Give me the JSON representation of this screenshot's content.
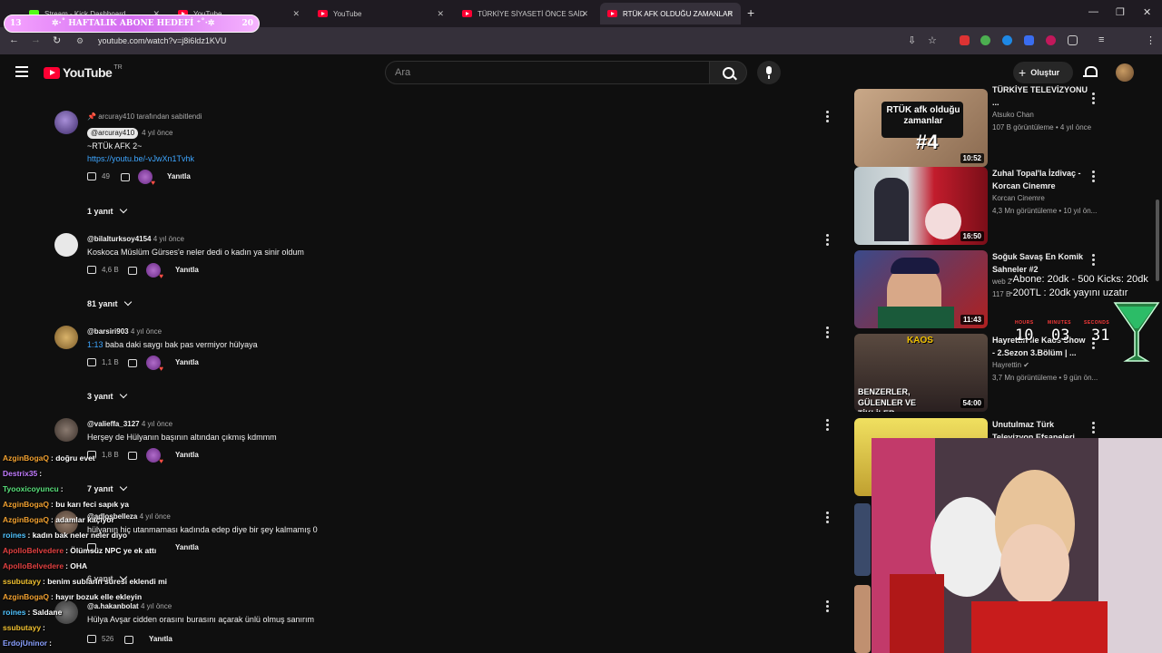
{
  "browser": {
    "tabs": [
      {
        "label": "Stream - Kick Dashboard",
        "type": "kick"
      },
      {
        "label": "YouTube",
        "type": "yt"
      },
      {
        "label": "YouTube",
        "type": "yt"
      },
      {
        "label": "TÜRKİYE SİYASETİ ÖNCE SAİD",
        "type": "yt"
      },
      {
        "label": "RTÜK AFK OLDUĞU ZAMANLAR",
        "type": "yt",
        "active": true
      }
    ],
    "url": "youtube.com/watch?v=j8i6ldz1KVU",
    "profile_letter": "C"
  },
  "overlay": {
    "banner_left": "13",
    "banner_text": "✲·˚ HAFTALIK ABONE HEDEFİ ⁺˚·✲",
    "banner_right": "20",
    "goal_line1": "-Abone: 20dk - 500 Kicks: 20dk",
    "goal_line2": "-200TL : 20dk yayını uzatır",
    "timer": {
      "hours_label": "HOURS",
      "minutes_label": "MINUTES",
      "seconds_label": "SECONDS",
      "hours": "10",
      "minutes": "03",
      "seconds": "31"
    }
  },
  "youtube": {
    "logo_text": "YouTube",
    "region": "TR",
    "search_placeholder": "Ara",
    "create_label": "Oluştur"
  },
  "comments": [
    {
      "pinned": "arcuray410 tarafından sabitlendi",
      "author": "@arcuray410",
      "time": "4 yıl önce",
      "text": "~RTÜk AFK 2~",
      "link": "https://youtu.be/-vJwXn1Tvhk",
      "likes": "49",
      "reply_label": "Yanıtla",
      "replies": "1 yanıt"
    },
    {
      "author": "@bilalturksoy4154",
      "time": "4 yıl önce",
      "text": "Koskoca Müslüm Gürses'e neler dedi o kadın ya sinir oldum",
      "likes": "4,6 B",
      "reply_label": "Yanıtla",
      "replies": "81 yanıt"
    },
    {
      "author": "@barsiri903",
      "time": "4 yıl önce",
      "timestamp_link": "1:13",
      "text": "baba daki saygı bak pas vermiyor hülyaya",
      "likes": "1,1 B",
      "reply_label": "Yanıtla",
      "replies": "3 yanıt"
    },
    {
      "author": "@valieffa_3127",
      "time": "4 yıl önce",
      "text": "Herşey de Hülyanın başının altından çıkmış kdmmm",
      "likes": "1,8 B",
      "reply_label": "Yanıtla",
      "replies": "7 yanıt"
    },
    {
      "author": "@adlosbelleza",
      "time": "4 yıl önce",
      "text": "hülyanın hiç utanmaması kadında edep diye bir şey kalmamış 0",
      "likes": "",
      "reply_label": "Yanıtla",
      "replies": "6 yanıt"
    },
    {
      "author": "@a.hakanbolat",
      "time": "4 yıl önce",
      "text": "Hülya Avşar cidden orasını burasını açarak ünlü olmuş sanırım",
      "likes": "526",
      "reply_label": "Yanıtla"
    }
  ],
  "recommendations": [
    {
      "title": "TÜRKİYE TELEVİZYONU ...",
      "channel": "Atsuko Chan",
      "stats": "107 B görüntüleme • 4 yıl önce",
      "duration": "10:52",
      "thumb_text": "RTÜK afk olduğu zamanlar",
      "thumb_num": "#4"
    },
    {
      "title": "Zuhal Topal'la İzdivaç - Korcan Cinemre",
      "channel": "Korcan Cinemre",
      "stats": "4,3 Mn görüntüleme • 10 yıl ön...",
      "duration": "16:50"
    },
    {
      "title": "Soğuk Savaş En Komik Sahneler #2",
      "channel": "web 2",
      "stats": "117 B",
      "duration": "11:43"
    },
    {
      "title": "Hayrettin ile Kaos Show - 2.Sezon 3.Bölüm | ...",
      "channel": "Hayrettin",
      "stats": "3,7 Mn görüntüleme • 9 gün ön...",
      "duration": "54:00",
      "thumb_text": "BENZERLER, GÜLENLER VE TİKLİLER",
      "thumb_brand": "KAOS"
    },
    {
      "title": "Unutulmaz Türk Televizyon Efsaneleri",
      "channel": "",
      "stats": "",
      "duration": ""
    }
  ],
  "chat": [
    {
      "user": "AzginBogaQ",
      "msg": ": doğru evet",
      "color": "#f0a030"
    },
    {
      "user": "Destrix35",
      "msg": ":",
      "color": "#c27cff"
    },
    {
      "user": "Tyooxicoyuncu",
      "msg": ":",
      "color": "#58e07a"
    },
    {
      "user": "AzginBogaQ",
      "msg": ": bu karı feci sapık ya",
      "color": "#f0a030"
    },
    {
      "user": "AzginBogaQ",
      "msg": ": adamlar kaçıyor",
      "color": "#f0a030"
    },
    {
      "user": "roines",
      "msg": ": kadın bak neler neler diyo",
      "color": "#4fc3ff"
    },
    {
      "user": "ApolloBelvedere",
      "msg": ": Ölümsüz NPC ye ek attı",
      "color": "#e04040"
    },
    {
      "user": "ApolloBelvedere",
      "msg": ": OHA",
      "color": "#e04040"
    },
    {
      "user": "ssubutayy",
      "msg": ": benim sublarin süresi eklendi mi",
      "color": "#f0c030"
    },
    {
      "user": "AzginBogaQ",
      "msg": ": hayır bozuk elle ekleyin",
      "color": "#f0a030"
    },
    {
      "user": "roines",
      "msg": ": Saldane",
      "color": "#4fc3ff"
    },
    {
      "user": "ssubutayy",
      "msg": ":",
      "color": "#f0c030"
    },
    {
      "user": "ErdojUninor",
      "msg": ":",
      "color": "#8aa0ff"
    }
  ]
}
